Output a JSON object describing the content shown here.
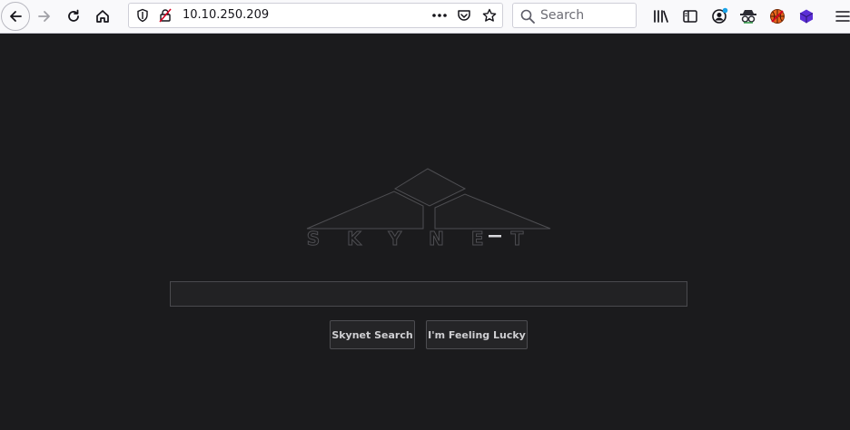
{
  "browser": {
    "url": "10.10.250.209",
    "search_placeholder": "Search"
  },
  "page": {
    "logo_text": "SKYNET",
    "query_value": "",
    "search_button": "Skynet Search",
    "lucky_button": "I'm Feeling Lucky"
  },
  "colors": {
    "page_background": "#1b1b1d",
    "logo_stroke": "#4e4e52",
    "toolbar": "#f9f9fb",
    "extension_blue": "#5b2fd6",
    "badge_dot": "#1aa3e8"
  },
  "icons": [
    "back-arrow",
    "forward-arrow",
    "reload",
    "home",
    "shield",
    "insecure-lock",
    "more-dots",
    "pocket",
    "star",
    "search",
    "library",
    "sidebar",
    "account",
    "incognito-extension",
    "basketball-extension",
    "cube-extension",
    "hamburger-menu",
    "microphone"
  ]
}
